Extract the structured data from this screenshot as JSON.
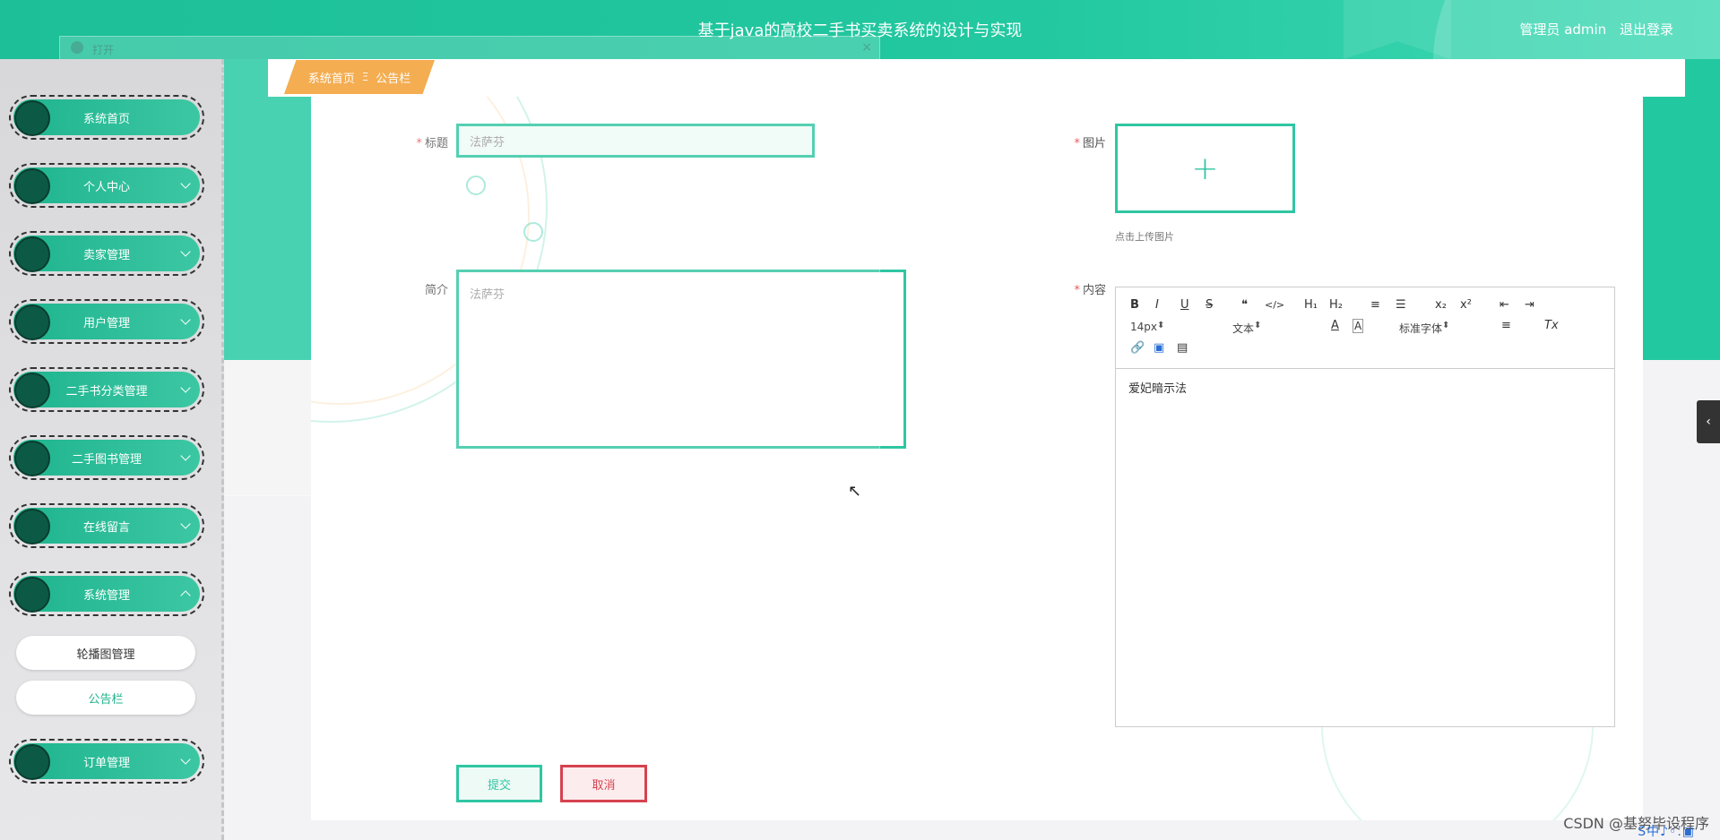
{
  "header": {
    "app_title": "基于java的高校二手书买卖系统的设计与实现",
    "user_label": "管理员 admin",
    "logout_label": "退出登录"
  },
  "sidebar": {
    "items": [
      {
        "label": "系统首页",
        "expandable": false
      },
      {
        "label": "个人中心",
        "expandable": true
      },
      {
        "label": "卖家管理",
        "expandable": true
      },
      {
        "label": "用户管理",
        "expandable": true
      },
      {
        "label": "二手书分类管理",
        "expandable": true
      },
      {
        "label": "二手图书管理",
        "expandable": true
      },
      {
        "label": "在线留言",
        "expandable": true
      },
      {
        "label": "系统管理",
        "expandable": true,
        "expanded": true
      },
      {
        "label": "订单管理",
        "expandable": true
      }
    ],
    "submenu": [
      {
        "label": "轮播图管理",
        "active": false
      },
      {
        "label": "公告栏",
        "active": true
      }
    ]
  },
  "breadcrumb": {
    "home": "系统首页",
    "separator": "Ξ",
    "current": "公告栏"
  },
  "form": {
    "title_label": "标题",
    "title_value": "法萨芬",
    "intro_label": "简介",
    "intro_value": "法萨芬",
    "image_label": "图片",
    "upload_hint": "点击上传图片",
    "content_label": "内容",
    "content_value": "爱妃暗示法",
    "submit_label": "提交",
    "cancel_label": "取消"
  },
  "editor": {
    "font_size": "14px",
    "block_type": "文本",
    "font_family": "标准字体",
    "buttons": [
      "B",
      "I",
      "U",
      "S",
      "❝",
      "</>",
      "H₁",
      "H₂",
      "≡",
      "☰",
      "x₂",
      "x²",
      "⇤",
      "⇥"
    ]
  },
  "ghost_dialog": {
    "title": "打开",
    "close": "×"
  },
  "side_handle_icon": "‹",
  "watermark": "CSDN @基努毕设程序",
  "tray": "S中♪◦⁚▣",
  "colors": {
    "primary": "#22c8a0",
    "accent": "#f29c2b",
    "danger": "#d6424f",
    "menu_dot": "#0c5a45"
  }
}
